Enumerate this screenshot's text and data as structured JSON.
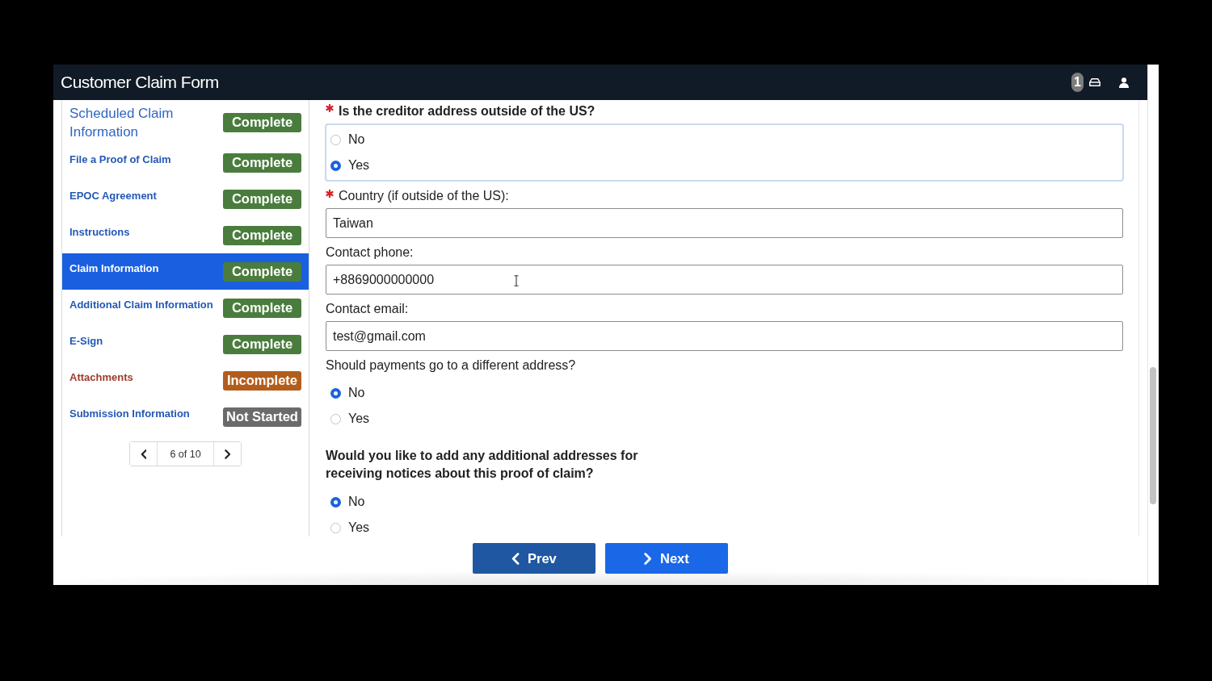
{
  "header": {
    "title": "Customer Claim Form",
    "notification_count": "1"
  },
  "sidebar": {
    "steps": [
      {
        "label": "Scheduled Claim Information",
        "kind": "heading",
        "selected": false,
        "error": false,
        "status": {
          "text": "Complete",
          "color": "#4a7d3d"
        }
      },
      {
        "label": "File a Proof of Claim",
        "kind": "step",
        "selected": false,
        "error": false,
        "status": {
          "text": "Complete",
          "color": "#4a7d3d"
        }
      },
      {
        "label": "EPOC Agreement",
        "kind": "step",
        "selected": false,
        "error": false,
        "status": {
          "text": "Complete",
          "color": "#4a7d3d"
        }
      },
      {
        "label": "Instructions",
        "kind": "step",
        "selected": false,
        "error": false,
        "status": {
          "text": "Complete",
          "color": "#4a7d3d"
        }
      },
      {
        "label": "Claim Information",
        "kind": "step",
        "selected": true,
        "error": false,
        "status": {
          "text": "Complete",
          "color": "#4a7d3d"
        }
      },
      {
        "label": "Additional Claim Information",
        "kind": "step",
        "selected": false,
        "error": false,
        "status": {
          "text": "Complete",
          "color": "#4a7d3d"
        }
      },
      {
        "label": "E-Sign",
        "kind": "step",
        "selected": false,
        "error": false,
        "status": {
          "text": "Complete",
          "color": "#4a7d3d"
        }
      },
      {
        "label": "Attachments",
        "kind": "step",
        "selected": false,
        "error": true,
        "status": {
          "text": "Incomplete",
          "color": "#b35d1d"
        }
      },
      {
        "label": "Submission Information",
        "kind": "step",
        "selected": false,
        "error": false,
        "status": {
          "text": "Not Started",
          "color": "#6b6b6b"
        }
      }
    ],
    "pager": {
      "text": "6 of 10"
    }
  },
  "form": {
    "fields": [
      {
        "kind": "radio",
        "label": "Is the creditor address outside of the US?",
        "required": true,
        "emphasized": true,
        "focused": true,
        "options": [
          {
            "label": "No",
            "selected": false
          },
          {
            "label": "Yes",
            "selected": true
          }
        ]
      },
      {
        "kind": "text",
        "label": "Country (if outside of the US):",
        "required": true,
        "value": "Taiwan",
        "hovered": false
      },
      {
        "kind": "text",
        "label": "Contact phone:",
        "required": false,
        "value": "+8869000000000",
        "hovered": true
      },
      {
        "kind": "text",
        "label": "Contact email:",
        "required": false,
        "value": "test@gmail.com",
        "hovered": false
      },
      {
        "kind": "radio",
        "label": "Should payments go to a different address?",
        "required": false,
        "emphasized": false,
        "focused": false,
        "options": [
          {
            "label": "No",
            "selected": true
          },
          {
            "label": "Yes",
            "selected": false
          }
        ]
      },
      {
        "kind": "radio",
        "label": "Would you like to add any additional addresses for receiving notices about this proof of claim?",
        "required": false,
        "emphasized": true,
        "focused": false,
        "options": [
          {
            "label": "No",
            "selected": true
          },
          {
            "label": "Yes",
            "selected": false
          }
        ]
      }
    ]
  },
  "footer": {
    "buttons": [
      {
        "label": "Prev",
        "kind": "prev"
      },
      {
        "label": "Next",
        "kind": "next"
      }
    ]
  }
}
